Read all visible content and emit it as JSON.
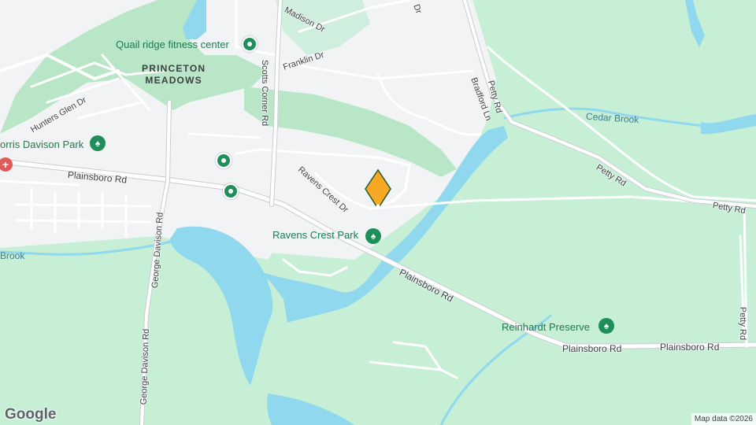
{
  "map": {
    "colors": {
      "land": "#f1f3f4",
      "green": "#c6efd6",
      "golf": "#b8e6c6",
      "water": "#90d8ee",
      "road": "#ffffff",
      "road_outline": "#d5d8dc",
      "marker": "#f9a825",
      "poi": "#1e8e5a"
    },
    "roads": {
      "madison": "Madison Dr",
      "franklin": "Franklin Dr",
      "scotts_corner": "Scotts Corner Rd",
      "bradford": "Bradford Ln",
      "petty_1": "Petty Rd",
      "petty_2": "Petty Rd",
      "petty_3": "Petty Rd",
      "petty_4": "Petty Rd",
      "hunters_glen": "Hunters Glen Dr",
      "plainsboro_1": "Plainsboro Rd",
      "plainsboro_2": "Plainsboro Rd",
      "plainsboro_3": "Plainsboro Rd",
      "plainsboro_4": "Plainsboro Rd",
      "ravens_crest": "Ravens Crest Dr",
      "george_davison_1": "George Davison Rd",
      "george_davison_2": "George Davison Rd",
      "dr_fragment": "Dr"
    },
    "water": {
      "cedar_brook": "Cedar Brook",
      "brook": "Brook"
    },
    "parks": {
      "morris_davison": "orris Davison Park",
      "ravens_crest": "Ravens Crest Park",
      "reinhardt": "Reinhardt Preserve"
    },
    "pois": {
      "quail_ridge": "Quail ridge fitness center"
    },
    "neighborhood": {
      "line1": "PRINCETON",
      "line2": "MEADOWS"
    },
    "attribution": {
      "logo": "Google",
      "text": "Map data ©2026"
    },
    "icons": {
      "pin": "location-pin-icon",
      "tree": "park-tree-icon",
      "hospital": "hospital-icon",
      "marker": "selected-location-marker-icon"
    }
  }
}
